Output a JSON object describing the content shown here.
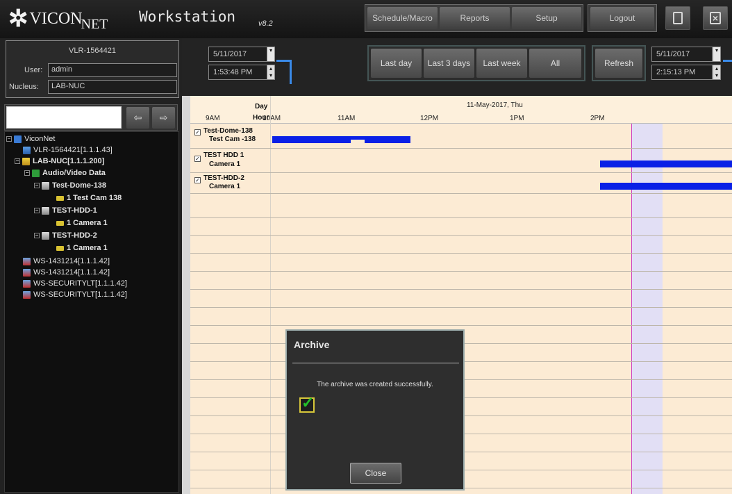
{
  "header": {
    "logo_text": "VICON",
    "logo_sub": "NET",
    "app_title": "Workstation",
    "version": "v8.2",
    "nav_buttons": [
      "Schedule/Macro",
      "Reports",
      "Setup"
    ],
    "logout": "Logout",
    "window_icons": [
      "minimize-icon",
      "close-icon"
    ]
  },
  "login": {
    "server": "VLR-1564421",
    "user_label": "User:",
    "user_value": "admin",
    "nucleus_label": "Nucleus:",
    "nucleus_value": "LAB-NUC"
  },
  "search": {
    "placeholder": ""
  },
  "tree": {
    "items": [
      {
        "label": "ViconNet",
        "icon": "network-icon"
      },
      {
        "label": "VLR-1564421[1.1.1.43]",
        "icon": "server-icon"
      },
      {
        "label": "LAB-NUC[1.1.1.200]",
        "icon": "nucleus-icon"
      },
      {
        "label": "Audio/Video Data",
        "icon": "av-data-icon"
      },
      {
        "label": "Test-Dome-138",
        "icon": "device-icon"
      },
      {
        "label": "1  Test Cam 138",
        "icon": "camera-icon"
      },
      {
        "label": "TEST-HDD-1",
        "icon": "device-icon"
      },
      {
        "label": "1  Camera 1",
        "icon": "camera-icon"
      },
      {
        "label": "TEST-HDD-2",
        "icon": "device-icon"
      },
      {
        "label": "1  Camera 1",
        "icon": "camera-icon"
      },
      {
        "label": "WS-1431214[1.1.1.42]",
        "icon": "workstation-icon"
      },
      {
        "label": "WS-1431214[1.1.1.42]",
        "icon": "workstation-icon"
      },
      {
        "label": "WS-SECURITYLT[1.1.1.42]",
        "icon": "workstation-icon"
      },
      {
        "label": "WS-SECURITYLT[1.1.1.42]",
        "icon": "workstation-icon"
      }
    ]
  },
  "controls": {
    "start_date": "5/11/2017",
    "start_time": "1:53:48 PM",
    "end_date": "5/11/2017",
    "end_time": "2:15:13 PM",
    "range_buttons": [
      "Last day",
      "Last 3 days",
      "Last week",
      "All"
    ],
    "refresh": "Refresh"
  },
  "timeline": {
    "day_label": "Day",
    "hour_label": "Hour",
    "date": "11-May-2017, Thu",
    "hours": [
      "9AM",
      "10AM",
      "11AM",
      "12PM",
      "1PM",
      "2PM"
    ],
    "rows": [
      {
        "device": "Test-Dome-138",
        "camera": "Test Cam -138"
      },
      {
        "device": "TEST HDD 1",
        "camera": "Camera 1"
      },
      {
        "device": "TEST-HDD-2",
        "camera": "Camera 1"
      }
    ],
    "colors": {
      "recording": "#0a20e6",
      "now_line": "#d040c0",
      "selection": "#e2dff5"
    }
  },
  "dialog": {
    "title": "Archive",
    "message": "The archive was created successfully.",
    "close": "Close"
  }
}
